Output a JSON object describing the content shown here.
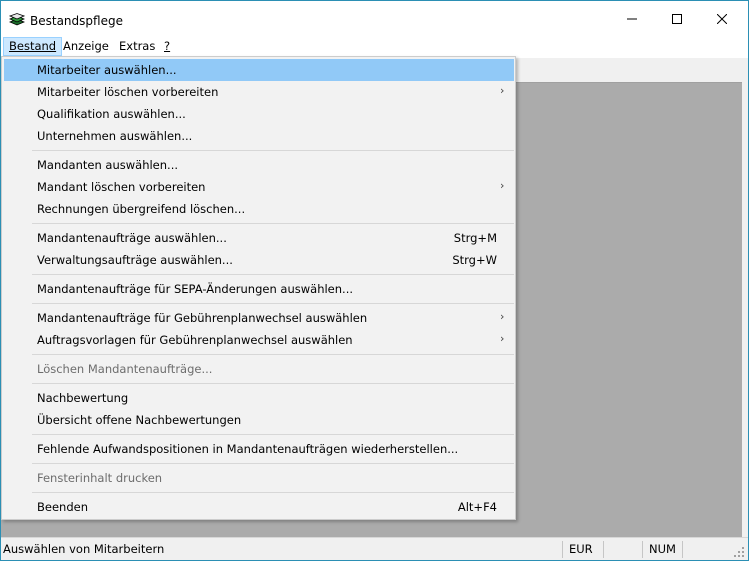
{
  "window": {
    "title": "Bestandspflege"
  },
  "menubar": {
    "items": [
      {
        "label": "Bestand"
      },
      {
        "label": "Anzeige"
      },
      {
        "label": "Extras"
      },
      {
        "label": "?"
      }
    ]
  },
  "menu": {
    "items": [
      {
        "label": "Mitarbeiter auswählen...",
        "highlighted": true
      },
      {
        "label": "Mitarbeiter löschen vorbereiten",
        "submenu": true
      },
      {
        "label": "Qualifikation auswählen..."
      },
      {
        "label": "Unternehmen auswählen..."
      },
      {
        "label": "Mandanten auswählen..."
      },
      {
        "label": "Mandant löschen vorbereiten",
        "submenu": true
      },
      {
        "label": "Rechnungen übergreifend löschen..."
      },
      {
        "label": "Mandantenaufträge auswählen...",
        "shortcut": "Strg+M"
      },
      {
        "label": "Verwaltungsaufträge auswählen...",
        "shortcut": "Strg+W"
      },
      {
        "label": "Mandantenaufträge für SEPA-Änderungen auswählen..."
      },
      {
        "label": "Mandantenaufträge für Gebührenplanwechsel auswählen",
        "submenu": true
      },
      {
        "label": "Auftragsvorlagen für Gebührenplanwechsel auswählen",
        "submenu": true
      },
      {
        "label": "Löschen Mandantenaufträge...",
        "disabled": true
      },
      {
        "label": "Nachbewertung"
      },
      {
        "label": "Übersicht offene Nachbewertungen"
      },
      {
        "label": "Fehlende Aufwandspositionen in Mandantenaufträgen wiederherstellen..."
      },
      {
        "label": "Fensterinhalt drucken",
        "disabled": true
      },
      {
        "label": "Beenden",
        "shortcut": "Alt+F4"
      }
    ],
    "submenu_arrow": "›"
  },
  "statusbar": {
    "message": "Auswählen von Mitarbeitern",
    "currency": "EUR",
    "num": "NUM"
  },
  "colors": {
    "highlight": "#91c9f7",
    "menubar_active": "#cce8ff",
    "mdi_background": "#ababab",
    "window_border": "#2b8fb4"
  }
}
